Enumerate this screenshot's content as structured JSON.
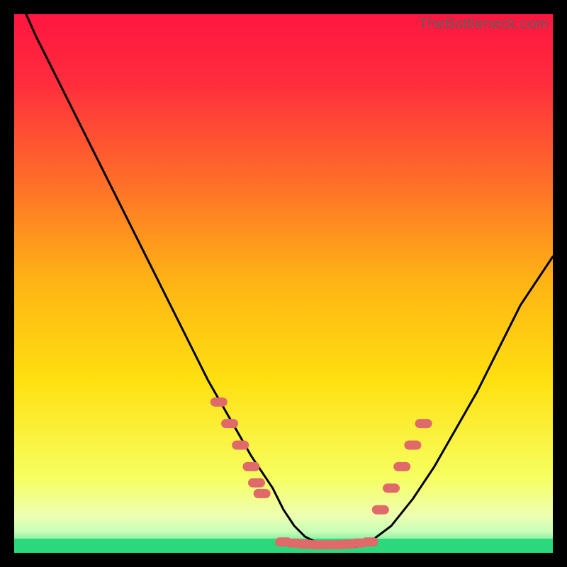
{
  "watermark": "TheBottleneck.com",
  "colors": {
    "bg": "#000000",
    "curve": "#000000",
    "marker": "#e06a6a",
    "bottom_band": "#2bd97c",
    "grad_top": "#ff1a3e",
    "grad_mid": "#ffd400",
    "grad_low": "#f9ff8a"
  },
  "chart_data": {
    "type": "line",
    "title": "",
    "xlabel": "",
    "ylabel": "",
    "xlim": [
      0,
      100
    ],
    "ylim": [
      0,
      100
    ],
    "x": [
      0,
      4,
      8,
      12,
      16,
      20,
      24,
      28,
      32,
      36,
      40,
      44,
      48,
      50,
      52,
      54,
      56,
      58,
      60,
      62,
      64,
      66,
      70,
      74,
      78,
      82,
      86,
      90,
      94,
      98,
      100
    ],
    "y": [
      105,
      96,
      88,
      80,
      72,
      64,
      56,
      48,
      40,
      32,
      25,
      18,
      12,
      8,
      5,
      3,
      2,
      1.2,
      1,
      1,
      1.2,
      2,
      5,
      10,
      16,
      23,
      30,
      38,
      46,
      52,
      55
    ],
    "markers_left": {
      "x": [
        38,
        40,
        42,
        44,
        45,
        46
      ],
      "y": [
        28,
        24,
        20,
        16,
        13,
        11
      ]
    },
    "markers_bottom": {
      "x": [
        50,
        52,
        54,
        56,
        58,
        60,
        62,
        64,
        66
      ],
      "y": [
        2.0,
        1.8,
        1.6,
        1.5,
        1.5,
        1.5,
        1.6,
        1.8,
        2.0
      ]
    },
    "markers_right": {
      "x": [
        68,
        70,
        72,
        74,
        76
      ],
      "y": [
        8,
        12,
        16,
        20,
        24
      ]
    }
  }
}
